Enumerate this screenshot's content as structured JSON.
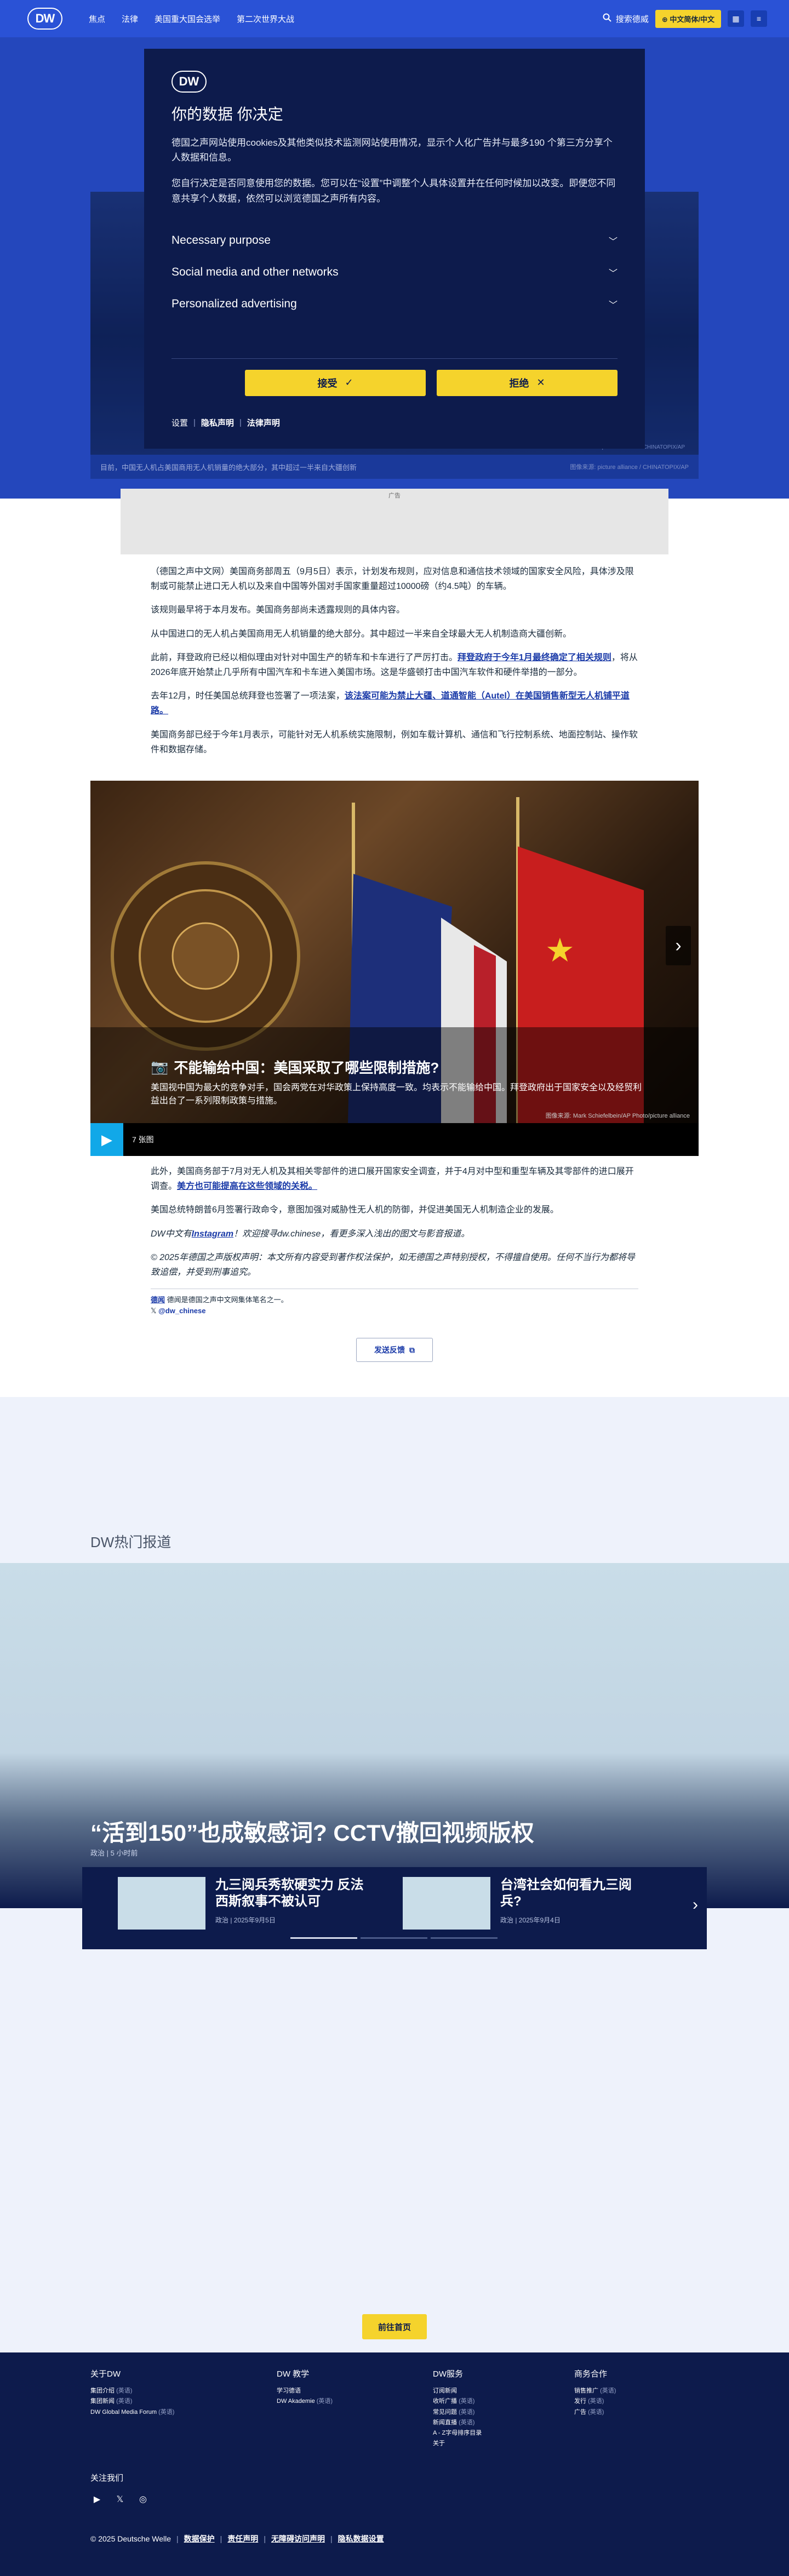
{
  "header": {
    "logo": "DW",
    "nav": [
      "焦点",
      "法律",
      "美国重大国会选举",
      "第二次世界大战"
    ],
    "search_label": "搜索德威",
    "lang_label": "⊕ 中文简体/中文",
    "square_label": "≡"
  },
  "cookie_modal": {
    "logo": "DW",
    "title": "你的数据 你决定",
    "p1": "德国之声网站使用cookies及其他类似技术监测网站使用情况，显示个人化广告并与最多190 个第三方分享个人数据和信息。",
    "p2": "您自行决定是否同意使用您的数据。您可以在“设置”中调整个人具体设置并在任何时候加以改变。即便您不同意共享个人数据，依然可以浏览德国之声所有内容。",
    "sections": [
      "Necessary purpose",
      "Social media and other networks",
      "Personalized advertising"
    ],
    "accept": "接受",
    "reject": "拒绝",
    "links": [
      "设置",
      "隐私声明",
      "法律声明"
    ]
  },
  "hero": {
    "caption": "目前，中国无人机占美国商用无人机销量的绝大部分，其中超过一半来自大疆创新",
    "source": "图像来源: picture alliance / CHINATOPIX/AP",
    "credit": "© picture alliance / CHINATOPIX/AP"
  },
  "ad": {
    "label": "广告"
  },
  "article": {
    "p1": "（德国之声中文网）美国商务部周五（9月5日）表示，计划发布规则，应对信息和通信技术领域的国家安全风险，具体涉及限制或可能禁止进口无人机以及来自中国等外国对手国家重量超过10000磅（约4.5吨）的车辆。",
    "p2": "该规则最早将于本月发布。美国商务部尚未透露规则的具体内容。",
    "p3": "从中国进口的无人机占美国商用无人机销量的绝大部分。其中超过一半来自全球最大无人机制造商大疆创新。",
    "p4a": "此前，拜登政府已经以相似理由对针对中国生产的轿车和卡车进行了严厉打击。",
    "p4link": "拜登政府于今年1月最终确定了相关规则",
    "p4b": "，将从2026年底开始禁止几乎所有中国汽车和卡车进入美国市场。这是华盛顿打击中国汽车软件和硬件举措的一部分。",
    "p5a": "去年12月，时任美国总统拜登也签署了一项法案，",
    "p5link": "该法案可能为禁止大疆、道通智能（Autel）在美国销售新型无人机铺平道路。",
    "p6": "美国商务部已经于今年1月表示，可能针对无人机系统实施限制，例如车载计算机、通信和飞行控制系统、地面控制站、操作软件和数据存储。"
  },
  "gallery": {
    "title": "不能输给中国：美国采取了哪些限制措施?",
    "desc": "美国视中国为最大的竞争对手，国会两党在对华政策上保持高度一致。均表示不能输给中国。拜登政府出于国家安全以及经贸利益出台了一系列限制政策与措施。",
    "credit": "图像来源: Mark Schiefelbein/AP Photo/picture alliance",
    "count": "7 张图",
    "next_icon": "›"
  },
  "article2": {
    "p7a": "此外，美国商务部于7月对无人机及其相关零部件的进口展开国家安全调查，并于4月对中型和重型车辆及其零部件的进口展开调查。",
    "p7link": "美方也可能提高在这些领域的关税。",
    "p8": "美国总统特朗普6月签署行政命令，意图加强对威胁性无人机的防御，并促进美国无人机制造企业的发展。",
    "p9a": "DW中文有",
    "p9link": "Instagram",
    "p9b": "！欢迎搜寻dw.chinese，看更多深入浅出的图文与影音报道。",
    "p10": "© 2025年德国之声版权声明：本文所有内容受到著作权法保护，如无德国之声特别授权，不得擅自使用。任何不当行为都将导致追偿，并受到刑事追究。",
    "author_name": "德闻",
    "author_desc": "德闻是德国之声中文网集体笔名之一。",
    "author_handle": "@dw_chinese",
    "feedback": "发送反馈"
  },
  "trending": {
    "heading": "DW热门报道",
    "main_title": "“活到150”也成敏感词? CCTV撤回视频版权",
    "main_meta": "政治 | 5 小时前",
    "teasers": [
      {
        "title": "九三阅兵秀软硬实力 反法西斯叙事不被认可",
        "meta": "政治 | 2025年9月5日"
      },
      {
        "title": "台湾社会如何看九三阅兵?",
        "meta": "政治 | 2025年9月4日"
      }
    ],
    "next_icon": "›"
  },
  "home_button": "前往首页",
  "footer": {
    "col1": {
      "title": "关于DW",
      "items": [
        [
          "集团介绍",
          "(英语)"
        ],
        [
          "集团新闻",
          "(英语)"
        ],
        [
          "DW Global Media Forum",
          "(英语)"
        ]
      ]
    },
    "col2": {
      "title": "DW 教学",
      "items": [
        [
          "学习德语",
          ""
        ],
        [
          "DW Akademie",
          "(英语)"
        ]
      ]
    },
    "col3": {
      "title": "DW服务",
      "items": [
        [
          "订阅新闻",
          ""
        ],
        [
          "收听广播",
          "(英语)"
        ],
        [
          "常见问题",
          "(英语)"
        ],
        [
          "新闻直播",
          "(英语)"
        ],
        [
          "A - Z字母排序目录",
          ""
        ],
        [
          "关于",
          ""
        ]
      ]
    },
    "col4": {
      "title": "商务合作",
      "items": [
        [
          "销售推广",
          "(英语)"
        ],
        [
          "发行",
          "(英语)"
        ],
        [
          "广告",
          "(英语)"
        ]
      ]
    },
    "follow": "关注我们",
    "bottom": {
      "copyright": "© 2025 Deutsche Welle",
      "links": [
        "数据保护",
        "责任声明",
        "无障碍访问声明",
        "隐私数据设置"
      ]
    }
  },
  "colors": {
    "brand_blue": "#2a52d6",
    "navy": "#0d1b4c",
    "yellow": "#f5d32c",
    "link": "#1a3aa8"
  }
}
